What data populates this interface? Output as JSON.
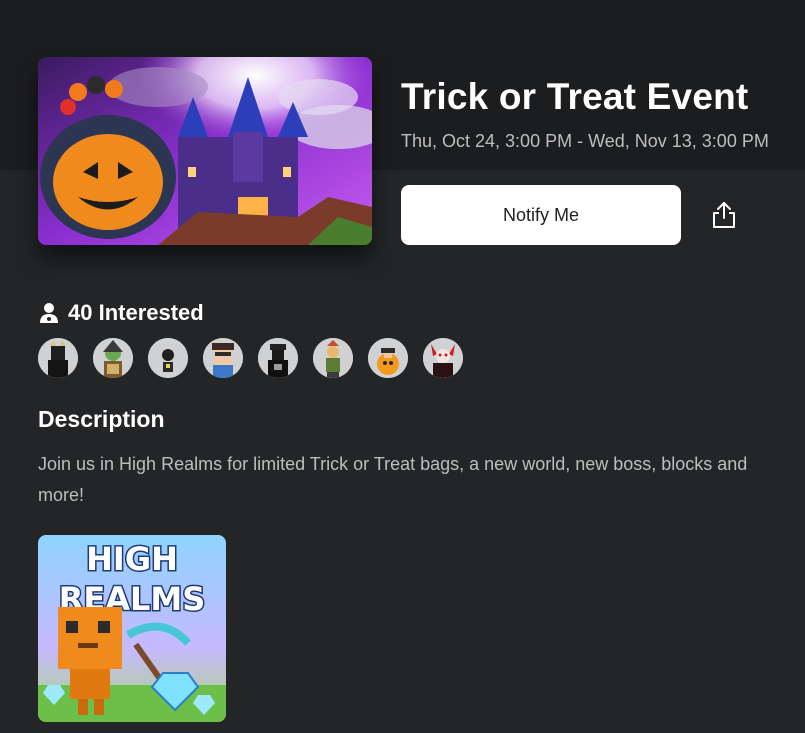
{
  "event": {
    "title": "Trick or Treat Event",
    "dates": "Thu, Oct 24, 3:00 PM - Wed, Nov 13, 3:00 PM",
    "banner_icon": "halloween-castle-banner"
  },
  "actions": {
    "notify_label": "Notify Me",
    "share_icon": "share-icon"
  },
  "interested": {
    "icon": "person-icon",
    "label": "40 Interested",
    "avatars": [
      {
        "icon": "avatar-1"
      },
      {
        "icon": "avatar-2"
      },
      {
        "icon": "avatar-3"
      },
      {
        "icon": "avatar-4"
      },
      {
        "icon": "avatar-5"
      },
      {
        "icon": "avatar-6"
      },
      {
        "icon": "avatar-7"
      },
      {
        "icon": "avatar-8"
      }
    ]
  },
  "description": {
    "heading": "Description",
    "text": "Join us in High Realms for limited Trick or Treat bags, a new world, new boss, blocks and more!"
  },
  "game": {
    "thumbnail_icon": "high-realms-thumbnail",
    "logo_line1": "HIGH",
    "logo_line2": "REALMS"
  },
  "colors": {
    "background": "#232527",
    "top_band": "#1c1d1f",
    "button_bg": "#ffffff",
    "secondary_text": "#bdbebe"
  }
}
